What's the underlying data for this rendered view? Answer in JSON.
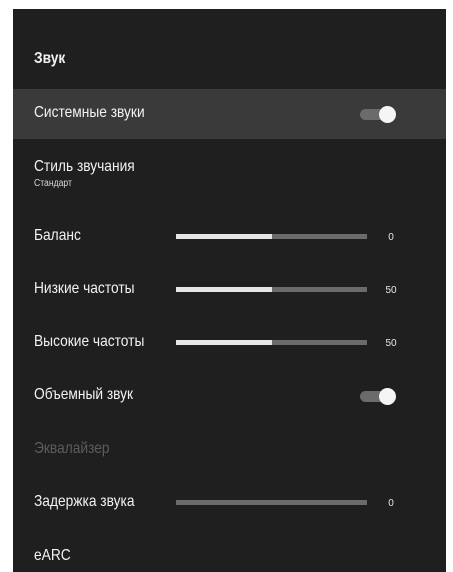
{
  "panel": {
    "title": "Звук"
  },
  "items": {
    "system_sounds": {
      "label": "Системные звуки",
      "toggle_on": true
    },
    "sound_style": {
      "label": "Стиль звучания",
      "value": "Стандарт"
    },
    "balance": {
      "label": "Баланс",
      "value": "0",
      "fill_fraction": 0.5
    },
    "bass": {
      "label": "Низкие частоты",
      "value": "50",
      "fill_fraction": 0.5
    },
    "treble": {
      "label": "Высокие частоты",
      "value": "50",
      "fill_fraction": 0.5
    },
    "surround": {
      "label": "Объемный звук",
      "toggle_on": true
    },
    "equalizer": {
      "label": "Эквалайзер",
      "disabled": true
    },
    "audio_delay": {
      "label": "Задержка звука",
      "value": "0",
      "fill_fraction": 0
    },
    "earc": {
      "label": "eARC"
    }
  },
  "colors": {
    "panel_bg": "#1f1f1f",
    "focus_bg": "#3a3a3a",
    "text": "#f2f2f2",
    "disabled_text": "#5c5c5c",
    "slider_track": "#6b6b6b",
    "slider_fill": "#e6e6e6"
  },
  "icons": {
    "toggle": "toggle-switch-icon"
  }
}
